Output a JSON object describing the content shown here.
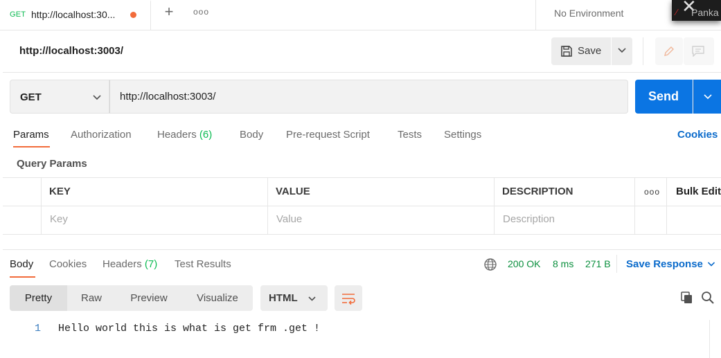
{
  "tabs": {
    "active": {
      "method": "GET",
      "title": "http://localhost:30..."
    },
    "environment": "No Environment",
    "overlay_user": "Panka"
  },
  "request": {
    "title": "http://localhost:3003/",
    "save_label": "Save",
    "method": "GET",
    "url": "http://localhost:3003/",
    "send_label": "Send",
    "tabs": [
      {
        "label": "Params"
      },
      {
        "label": "Authorization"
      },
      {
        "label": "Headers",
        "count": "(6)"
      },
      {
        "label": "Body"
      },
      {
        "label": "Pre-request Script"
      },
      {
        "label": "Tests"
      },
      {
        "label": "Settings"
      }
    ],
    "cookies_label": "Cookies"
  },
  "query_params": {
    "title": "Query Params",
    "columns": [
      "KEY",
      "VALUE",
      "DESCRIPTION"
    ],
    "bulk_edit": "Bulk Edit",
    "placeholders": {
      "key": "Key",
      "value": "Value",
      "description": "Description"
    }
  },
  "response": {
    "tabs": [
      {
        "label": "Body"
      },
      {
        "label": "Cookies"
      },
      {
        "label": "Headers",
        "count": "(7)"
      },
      {
        "label": "Test Results"
      }
    ],
    "status": "200 OK",
    "time": "8 ms",
    "size": "271 B",
    "save_label": "Save Response",
    "view_modes": [
      "Pretty",
      "Raw",
      "Preview",
      "Visualize"
    ],
    "format": "HTML",
    "lines": [
      {
        "no": "1",
        "text": "Hello world this is what is get frm .get !"
      }
    ]
  },
  "colors": {
    "accent": "#f26b3a",
    "send": "#0b75e3",
    "link": "#0b6bcb",
    "success": "#0cbb52"
  }
}
